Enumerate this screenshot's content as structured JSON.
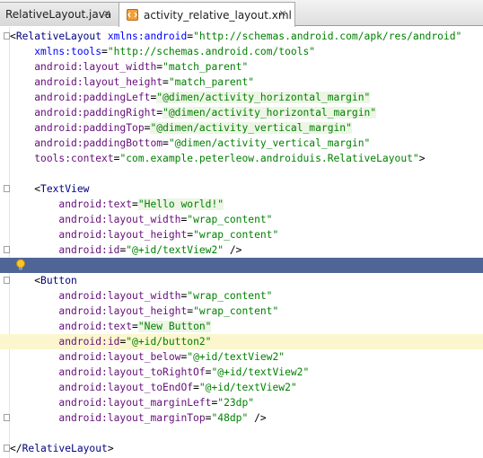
{
  "tabs": [
    {
      "label": "RelativeLayout.java",
      "icon": "java-class-icon",
      "close": "×",
      "active": false
    },
    {
      "label": "activity_relative_layout.xml",
      "icon": "xml-file-icon",
      "close": "×",
      "active": true
    }
  ],
  "colors": {
    "tag": "#000080",
    "attribute": "#660e7a",
    "value": "#008000",
    "selection": "#4f6596",
    "caret_row": "#fbf6cd"
  },
  "code": [
    [
      [
        "punct",
        "<"
      ],
      [
        "tag",
        "RelativeLayout "
      ],
      [
        "attr-plain",
        "xmlns:android"
      ],
      [
        "punct",
        "="
      ],
      [
        "val",
        "\"http://schemas.android.com/apk/res/android\""
      ]
    ],
    [
      [
        "punct",
        "    "
      ],
      [
        "attr-plain",
        "xmlns:tools"
      ],
      [
        "punct",
        "="
      ],
      [
        "val",
        "\"http://schemas.android.com/tools\""
      ]
    ],
    [
      [
        "punct",
        "    "
      ],
      [
        "attr",
        "android:layout_width"
      ],
      [
        "punct",
        "="
      ],
      [
        "val",
        "\"match_parent\""
      ]
    ],
    [
      [
        "punct",
        "    "
      ],
      [
        "attr",
        "android:layout_height"
      ],
      [
        "punct",
        "="
      ],
      [
        "val",
        "\"match_parent\""
      ]
    ],
    [
      [
        "punct",
        "    "
      ],
      [
        "attr",
        "android:paddingLeft"
      ],
      [
        "punct",
        "="
      ],
      [
        "val-hl",
        "\"@dimen/activity_horizontal_margin\""
      ]
    ],
    [
      [
        "punct",
        "    "
      ],
      [
        "attr",
        "android:paddingRight"
      ],
      [
        "punct",
        "="
      ],
      [
        "val-hl",
        "\"@dimen/activity_horizontal_margin\""
      ]
    ],
    [
      [
        "punct",
        "    "
      ],
      [
        "attr",
        "android:paddingTop"
      ],
      [
        "punct",
        "="
      ],
      [
        "val-hl",
        "\"@dimen/activity_vertical_margin\""
      ]
    ],
    [
      [
        "punct",
        "    "
      ],
      [
        "attr",
        "android:paddingBottom"
      ],
      [
        "punct",
        "="
      ],
      [
        "val",
        "\"@dimen/activity_vertical_margin\""
      ]
    ],
    [
      [
        "punct",
        "    "
      ],
      [
        "attr",
        "tools:context"
      ],
      [
        "punct",
        "="
      ],
      [
        "val",
        "\"com.example.peterleow.androiduis.RelativeLayout\""
      ],
      [
        "punct",
        ">"
      ]
    ],
    [],
    [
      [
        "punct",
        "    <"
      ],
      [
        "tag",
        "TextView"
      ]
    ],
    [
      [
        "punct",
        "        "
      ],
      [
        "attr",
        "android:text"
      ],
      [
        "punct",
        "="
      ],
      [
        "val-hl",
        "\"Hello world!\""
      ]
    ],
    [
      [
        "punct",
        "        "
      ],
      [
        "attr",
        "android:layout_width"
      ],
      [
        "punct",
        "="
      ],
      [
        "val",
        "\"wrap_content\""
      ]
    ],
    [
      [
        "punct",
        "        "
      ],
      [
        "attr",
        "android:layout_height"
      ],
      [
        "punct",
        "="
      ],
      [
        "val",
        "\"wrap_content\""
      ]
    ],
    [
      [
        "punct",
        "        "
      ],
      [
        "attr",
        "android:id"
      ],
      [
        "punct",
        "="
      ],
      [
        "val",
        "\"@+id/textView2\""
      ],
      [
        "punct",
        " />"
      ]
    ],
    [],
    [
      [
        "punct",
        "    <"
      ],
      [
        "tag",
        "Button"
      ]
    ],
    [
      [
        "punct",
        "        "
      ],
      [
        "attr",
        "android:layout_width"
      ],
      [
        "punct",
        "="
      ],
      [
        "val",
        "\"wrap_content\""
      ]
    ],
    [
      [
        "punct",
        "        "
      ],
      [
        "attr",
        "android:layout_height"
      ],
      [
        "punct",
        "="
      ],
      [
        "val",
        "\"wrap_content\""
      ]
    ],
    [
      [
        "punct",
        "        "
      ],
      [
        "attr",
        "android:text"
      ],
      [
        "punct",
        "="
      ],
      [
        "val-hl",
        "\"New Button\""
      ]
    ],
    [
      [
        "punct",
        "        "
      ],
      [
        "attr",
        "android:id"
      ],
      [
        "punct",
        "="
      ],
      [
        "val",
        "\"@+id/button2\""
      ]
    ],
    [
      [
        "punct",
        "        "
      ],
      [
        "attr",
        "android:layout_below"
      ],
      [
        "punct",
        "="
      ],
      [
        "val",
        "\"@+id/textView2\""
      ]
    ],
    [
      [
        "punct",
        "        "
      ],
      [
        "attr",
        "android:layout_toRightOf"
      ],
      [
        "punct",
        "="
      ],
      [
        "val",
        "\"@+id/textView2\""
      ]
    ],
    [
      [
        "punct",
        "        "
      ],
      [
        "attr",
        "android:layout_toEndOf"
      ],
      [
        "punct",
        "="
      ],
      [
        "val",
        "\"@+id/textView2\""
      ]
    ],
    [
      [
        "punct",
        "        "
      ],
      [
        "attr",
        "android:layout_marginLeft"
      ],
      [
        "punct",
        "="
      ],
      [
        "val",
        "\"23dp\""
      ]
    ],
    [
      [
        "punct",
        "        "
      ],
      [
        "attr",
        "android:layout_marginTop"
      ],
      [
        "punct",
        "="
      ],
      [
        "val",
        "\"48dp\""
      ],
      [
        "punct",
        " />"
      ]
    ],
    [],
    [
      [
        "punct",
        "</"
      ],
      [
        "tag",
        "RelativeLayout"
      ],
      [
        "punct",
        ">"
      ]
    ]
  ],
  "selected_line": 15,
  "caret_line": 20
}
